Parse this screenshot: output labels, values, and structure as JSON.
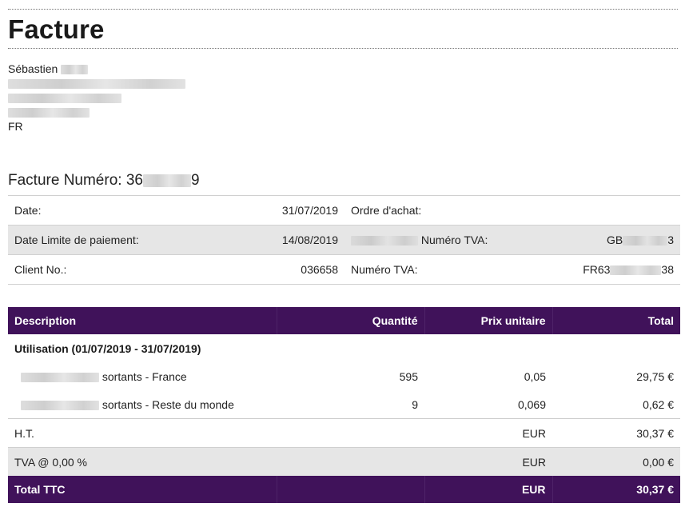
{
  "title": "Facture",
  "address": {
    "name": "Sébastien",
    "country": "FR"
  },
  "invoice": {
    "number_label": "Facture Numéro:",
    "number_prefix": "36",
    "number_suffix": "9"
  },
  "info": {
    "date_label": "Date:",
    "date_value": "31/07/2019",
    "po_label": "Ordre d'achat:",
    "due_label": "Date Limite de paiement:",
    "due_value": "14/08/2019",
    "vat_label_1": "Numéro TVA:",
    "vat_value_1_prefix": "GB",
    "vat_value_1_suffix": "3",
    "client_label": "Client No.:",
    "client_value": "036658",
    "vat_label_2": "Numéro TVA:",
    "vat_value_2_prefix": "FR63",
    "vat_value_2_suffix": "38"
  },
  "table": {
    "headers": {
      "description": "Description",
      "quantity": "Quantité",
      "unit_price": "Prix unitaire",
      "total": "Total"
    },
    "group_label": "Utilisation (01/07/2019 - 31/07/2019)",
    "items": [
      {
        "description": "sortants - France",
        "quantity": "595",
        "unit_price": "0,05",
        "total": "29,75 €"
      },
      {
        "description": "sortants - Reste du monde",
        "quantity": "9",
        "unit_price": "0,069",
        "total": "0,62 €"
      }
    ],
    "ht": {
      "label": "H.T.",
      "currency": "EUR",
      "value": "30,37 €"
    },
    "tva": {
      "label": "TVA @ 0,00 %",
      "currency": "EUR",
      "value": "0,00 €"
    },
    "total": {
      "label": "Total TTC",
      "currency": "EUR",
      "value": "30,37 €"
    }
  }
}
